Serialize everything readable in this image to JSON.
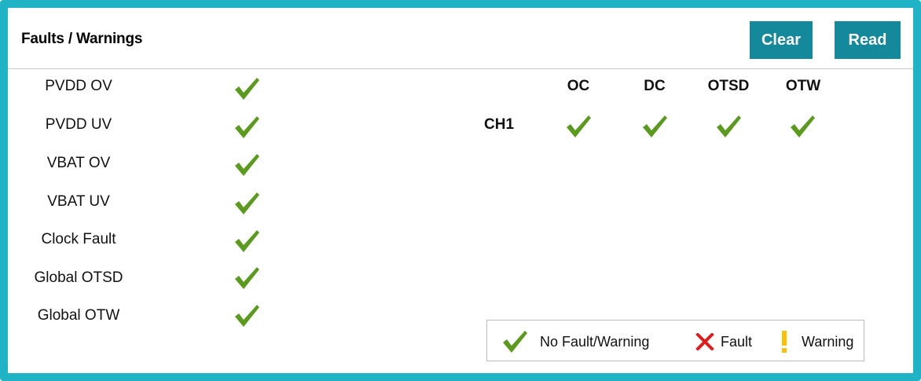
{
  "panel": {
    "title": "Faults / Warnings",
    "clear_label": "Clear",
    "read_label": "Read"
  },
  "global_faults": [
    {
      "label": "PVDD OV",
      "status": "no-fault"
    },
    {
      "label": "PVDD UV",
      "status": "no-fault"
    },
    {
      "label": "VBAT OV",
      "status": "no-fault"
    },
    {
      "label": "VBAT UV",
      "status": "no-fault"
    },
    {
      "label": "Clock Fault",
      "status": "no-fault"
    },
    {
      "label": "Global OTSD",
      "status": "no-fault"
    },
    {
      "label": "Global OTW",
      "status": "no-fault"
    }
  ],
  "channel_table": {
    "columns": [
      "OC",
      "DC",
      "OTSD",
      "OTW"
    ],
    "rows": [
      {
        "label": "CH1",
        "statuses": [
          "no-fault",
          "no-fault",
          "no-fault",
          "no-fault"
        ]
      }
    ]
  },
  "legend": {
    "no_fault": "No Fault/Warning",
    "fault": "Fault",
    "warning": "Warning"
  },
  "colors": {
    "frame": "#1fb3c5",
    "button": "#13899b",
    "check": "#5a9a1c",
    "fault": "#e11b1b",
    "warning": "#ffc000"
  },
  "icons": {
    "no_fault": "check-icon",
    "fault": "x-icon",
    "warning": "exclamation-icon"
  }
}
